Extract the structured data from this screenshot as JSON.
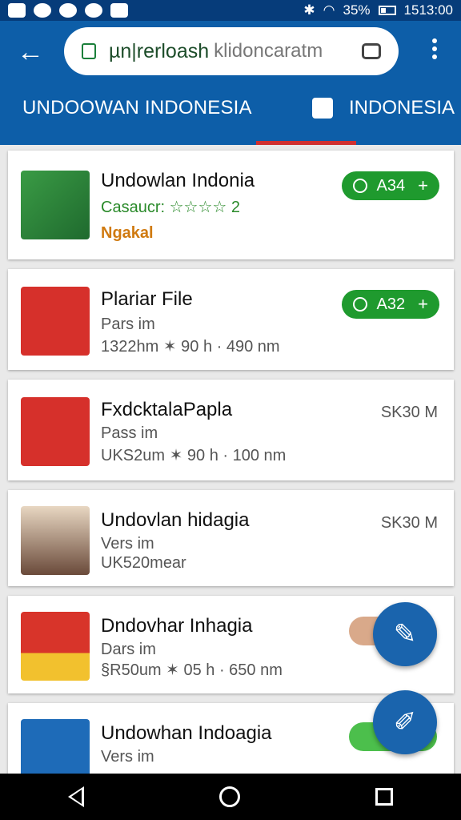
{
  "status": {
    "battery": "35%",
    "time": "1513:00"
  },
  "toolbar": {
    "search_query": "µn|rerloash",
    "search_rest": "klidoncaratm"
  },
  "tabs": [
    {
      "label": "UNDOOWAN INDONESIA"
    },
    {
      "label": "INDONESIA"
    }
  ],
  "apps": [
    {
      "title": "Undowlan Indonia",
      "line1": "Casaucr: ☆☆☆☆ 2",
      "line2": "Ngakal",
      "action": "A34",
      "thumb_color": "#2e8b3a"
    },
    {
      "title": "Plariar File",
      "line1": "Pars im",
      "line2": "1322hm ✶ 90 h · 490 nm",
      "action": "A32",
      "thumb_color": "#d6302b"
    },
    {
      "title": "FxdcktalaPapla",
      "line1": "Pass im",
      "line2": "UKS2um ✶ 90 h · 100 nm",
      "size": "SK30 M",
      "thumb_color": "#d6302b"
    },
    {
      "title": "Undovlan hidagia",
      "line1": "Vers im",
      "line2": "UK520mear",
      "size": "SK30 M",
      "thumb_color": "#6a4a3a"
    },
    {
      "title": "Dndovhar Inhagia",
      "line1": "Dars im",
      "line2": "§R50um ✶ 05 h · 650 nm",
      "thumb_color": "#d8342a"
    },
    {
      "title": "Undowhan Indoagia",
      "line1": "Vers im",
      "line2": "",
      "thumb_color": "#1e6bb8"
    }
  ],
  "colors": {
    "primary": "#0d5ea8",
    "accent_green": "#1f9a2e",
    "tab_indicator": "#d03030",
    "fab": "#1a64ad"
  }
}
